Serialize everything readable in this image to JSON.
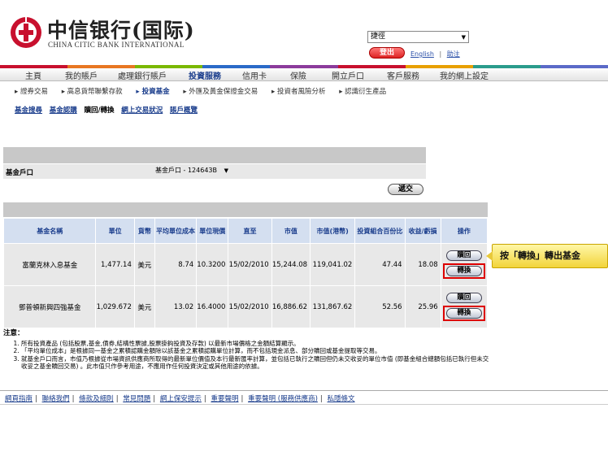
{
  "header": {
    "bank_name_cn": "中信银行(国际)",
    "bank_name_en": "CHINA CITIC BANK INTERNATIONAL",
    "lang_select": "捷徑",
    "logout_label": "登出",
    "english_link": "English",
    "help_link": "助注"
  },
  "nav": {
    "items": [
      "主頁",
      "我的賬戶",
      "處理銀行賬戶",
      "投資服務",
      "信用卡",
      "保險",
      "開立戶口",
      "客戶服務",
      "我的網上設定"
    ],
    "active_label": "投資服務"
  },
  "subnav": {
    "items": [
      "證券交易",
      "高息貨幣聯繫存款",
      "投資基金",
      "外匯及黃金保證金交易",
      "投資者風險分析",
      "認識衍生產品"
    ],
    "active": "投資基金"
  },
  "subsubnav": {
    "items": [
      "基金搜尋",
      "基金認購",
      "贖回/轉換",
      "網上交易狀況",
      "賬戶概覽"
    ],
    "current": "贖回/轉換"
  },
  "account": {
    "label": "基金戶口",
    "selected": "基金戶口 - 124643B"
  },
  "submit_label": "遞交",
  "table": {
    "headers": [
      "基金名稱",
      "單位",
      "貨幣",
      "平均單位成本",
      "單位現價",
      "直至",
      "市值",
      "市值(港幣)",
      "投資組合百份比",
      "收益/虧損",
      "操作"
    ],
    "rows": [
      {
        "name": "富蘭克林入息基金",
        "units": "1,477.14",
        "ccy": "美元",
        "avg_cost": "8.74",
        "price": "10.3200",
        "date": "15/02/2010",
        "mkt": "15,244.08",
        "mkt_hkd": "119,041.02",
        "pct": "47.44",
        "pl": "18.08"
      },
      {
        "name": "鄧普頓新興四強基金",
        "units": "1,029.672",
        "ccy": "美元",
        "avg_cost": "13.02",
        "price": "16.4000",
        "date": "15/02/2010",
        "mkt": "16,886.62",
        "mkt_hkd": "131,867.62",
        "pct": "52.56",
        "pl": "25.96"
      }
    ],
    "redeem_label": "贖回",
    "switch_label": "轉換"
  },
  "callout": "按「轉換」轉出基金",
  "notes": {
    "title": "注意：",
    "items": [
      "所有投資產品 (包括股票,基金,債券,結構性票據,股票掛鈎投資及存款) 以最新市場價格之金額結算顯示。",
      "「平均單位成本」是根據同一基金之累積認購金額除以該基金之累積認購單位計算，而不包括現金派息、部分贖回或基金提取等交易。",
      "就基金戶口而言，市值乃根據從市場資訊供應商所取得的最新單位價值及本行最新匯率計算，並包括已執行之贖回但仍未交收妥的單位市值 (即基金組合總額包括已執行但未交收妥之基金贖回交易) 。此市值只作參考用途，不應用作任何投資決定或其他用途的依據。"
    ]
  },
  "footer": {
    "links": [
      "網頁指南",
      "聯絡我們",
      "條款及細則",
      "常見問題",
      "網上保安提示",
      "重要聲明",
      "重要聲明 (服務供應商)",
      "私隱條文"
    ]
  },
  "colors": {
    "brand_red": "#c8102e",
    "nav_blue": "#1a3d8c",
    "highlight_red": "#dd0000",
    "callout_yellow": "#f2d43a"
  }
}
